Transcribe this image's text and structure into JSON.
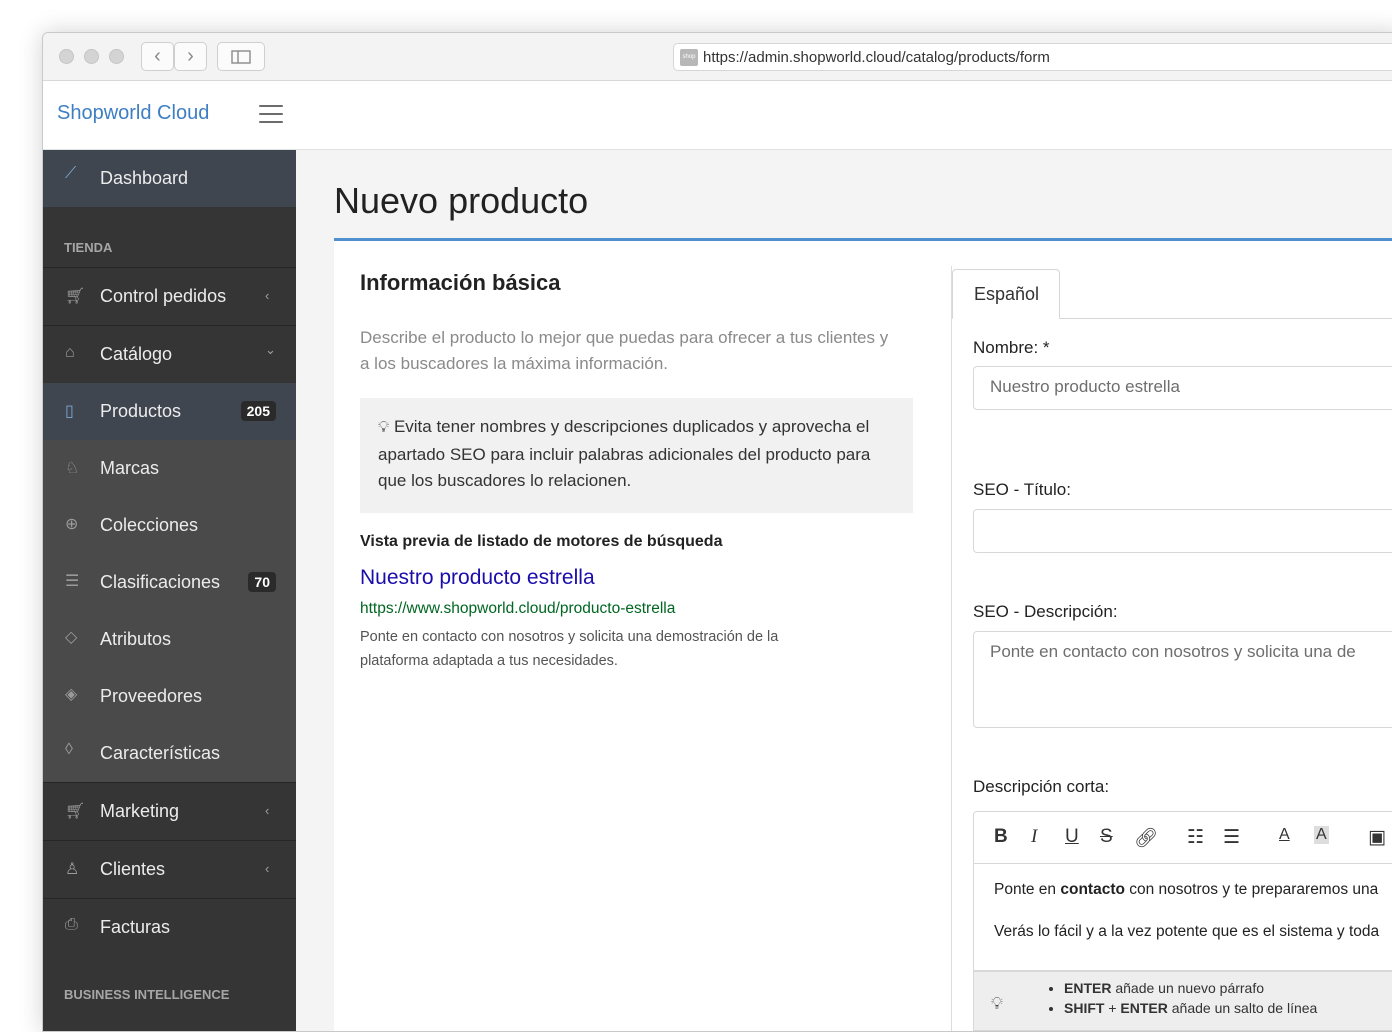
{
  "browser": {
    "url": "https://admin.shopworld.cloud/catalog/products/form",
    "favicon_text": "shop"
  },
  "topnav": {
    "brand": "Shopworld Cloud"
  },
  "sidebar": {
    "dashboard": "Dashboard",
    "section_store": "TIENDA",
    "items": [
      {
        "label": "Control pedidos",
        "icon": "cart-icon",
        "chevron": "‹"
      },
      {
        "label": "Catálogo",
        "icon": "bag-icon",
        "chevron": "⌄"
      },
      {
        "label": "Productos",
        "icon": "clipboard-icon",
        "badge": "205"
      },
      {
        "label": "Marcas",
        "icon": "award-icon"
      },
      {
        "label": "Colecciones",
        "icon": "crosshair-icon"
      },
      {
        "label": "Clasificaciones",
        "icon": "list-icon",
        "badge": "70"
      },
      {
        "label": "Atributos",
        "icon": "tag-icon"
      },
      {
        "label": "Proveedores",
        "icon": "diamond-icon"
      },
      {
        "label": "Características",
        "icon": "tags-icon"
      },
      {
        "label": "Marketing",
        "icon": "cart-icon",
        "chevron": "‹"
      },
      {
        "label": "Clientes",
        "icon": "users-icon",
        "chevron": "‹"
      },
      {
        "label": "Facturas",
        "icon": "printer-icon"
      }
    ],
    "section_bi": "BUSINESS INTELLIGENCE"
  },
  "main": {
    "page_title": "Nuevo producto",
    "basic": {
      "title": "Información básica",
      "description": "Describe el producto lo mejor que puedas para ofrecer a tus clientes y a los buscadores la máxima información.",
      "tip": "Evita tener nombres y descripciones duplicados y aprovecha el apartado SEO para incluir palabras adicionales del producto para que los buscadores lo relacionen."
    },
    "seo_preview": {
      "heading": "Vista previa de listado de motores de búsqueda",
      "title": "Nuestro producto estrella",
      "url": "https://www.shopworld.cloud/producto-estrella",
      "description": "Ponte en contacto con nosotros y solicita una demostración de la plataforma adaptada a tus necesidades."
    },
    "form": {
      "tab": "Español",
      "name_label": "Nombre: *",
      "name_value": "Nuestro producto estrella",
      "seo_title_label": "SEO - Título:",
      "seo_title_value": "",
      "seo_desc_label": "SEO - Descripción:",
      "seo_desc_value": "Ponte en contacto con nosotros y solicita una de",
      "short_desc_label": "Descripción corta:",
      "editor_p1_before": "Ponte en ",
      "editor_p1_bold": "contacto",
      "editor_p1_after": " con nosotros y te prepararemos una",
      "editor_p2": "Verás lo fácil y a la vez potente que es el sistema y toda",
      "help_enter_key": "ENTER",
      "help_enter_text": " añade un nuevo párrafo",
      "help_shift_key": "SHIFT",
      "help_plus": " + ",
      "help_shift_enter_key": "ENTER",
      "help_shift_text": " añade un salto de línea"
    }
  }
}
